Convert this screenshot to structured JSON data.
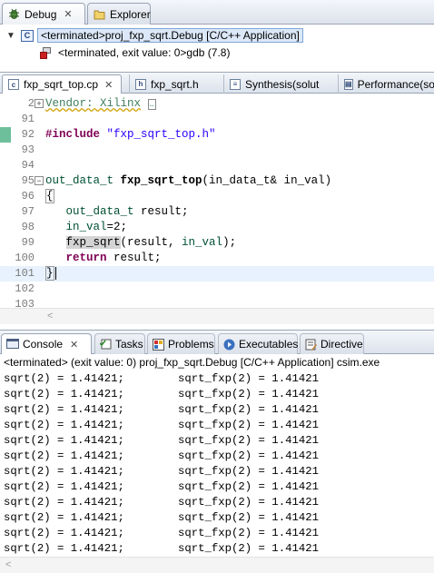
{
  "debug_view": {
    "tabs": [
      {
        "label": "Debug",
        "icon": "debug-bug-icon"
      },
      {
        "label": "Explorer",
        "icon": "folder-icon"
      }
    ],
    "tree": [
      {
        "label": "<terminated>proj_fxp_sqrt.Debug [C/C++ Application]",
        "icon": "c-application-icon"
      },
      {
        "label": "<terminated, exit value: 0>gdb (7.8)",
        "icon": "gdb-process-icon"
      }
    ]
  },
  "editor": {
    "tabs": [
      {
        "label": "fxp_sqrt_top.cp",
        "icon": "c-source-file-icon"
      },
      {
        "label": "fxp_sqrt.h",
        "icon": "header-file-icon"
      },
      {
        "label": "Synthesis(solut",
        "icon": "synthesis-report-icon"
      },
      {
        "label": "Performance(so",
        "icon": "performance-icon"
      }
    ],
    "lines": [
      {
        "num": "2",
        "text": "Vendor: Xilinx "
      },
      {
        "num": "91",
        "text": ""
      },
      {
        "num": "92",
        "text": "#include \"fxp_sqrt_top.h\""
      },
      {
        "num": "93",
        "text": ""
      },
      {
        "num": "94",
        "text": ""
      },
      {
        "num": "95",
        "text": "out_data_t fxp_sqrt_top(in_data_t& in_val)"
      },
      {
        "num": "96",
        "text": "{"
      },
      {
        "num": "97",
        "text": "   out_data_t result;"
      },
      {
        "num": "98",
        "text": "   in_val=2;"
      },
      {
        "num": "99",
        "text": "   fxp_sqrt(result, in_val);"
      },
      {
        "num": "100",
        "text": "   return result;"
      },
      {
        "num": "101",
        "text": "}"
      },
      {
        "num": "102",
        "text": ""
      },
      {
        "num": "103",
        "text": ""
      }
    ],
    "tokens": {
      "l2": "Vendor: Xilinx",
      "l92_kw": "#include",
      "l92_str": "\"fxp_sqrt_top.h\"",
      "l95_type": "out_data_t",
      "l95_fn": "fxp_sqrt_top",
      "l95_rest": "(in_data_t& in_val)",
      "l96": "{",
      "l97_type": "out_data_t",
      "l97_rest": " result;",
      "l98_var": "in_val",
      "l98_rest": "=2;",
      "l99_fn": "fxp_sqrt",
      "l99_rest": "(result, ",
      "l99_var": "in_val",
      "l99_end": ");",
      "l100_kw": "return",
      "l100_rest": " result;",
      "l101": "}"
    }
  },
  "console": {
    "tabs": [
      {
        "label": "Console",
        "icon": "console-icon"
      },
      {
        "label": "Tasks",
        "icon": "tasks-icon"
      },
      {
        "label": "Problems",
        "icon": "problems-icon"
      },
      {
        "label": "Executables",
        "icon": "executables-icon"
      },
      {
        "label": "Directive",
        "icon": "directive-icon"
      }
    ],
    "status": "<terminated> (exit value: 0) proj_fxp_sqrt.Debug [C/C++ Application] csim.exe",
    "rows": [
      {
        "a": "sqrt(2) = 1.41421;",
        "b": "sqrt_fxp(2) = 1.41421"
      },
      {
        "a": "sqrt(2) = 1.41421;",
        "b": "sqrt_fxp(2) = 1.41421"
      },
      {
        "a": "sqrt(2) = 1.41421;",
        "b": "sqrt_fxp(2) = 1.41421"
      },
      {
        "a": "sqrt(2) = 1.41421;",
        "b": "sqrt_fxp(2) = 1.41421"
      },
      {
        "a": "sqrt(2) = 1.41421;",
        "b": "sqrt_fxp(2) = 1.41421"
      },
      {
        "a": "sqrt(2) = 1.41421;",
        "b": "sqrt_fxp(2) = 1.41421"
      },
      {
        "a": "sqrt(2) = 1.41421;",
        "b": "sqrt_fxp(2) = 1.41421"
      },
      {
        "a": "sqrt(2) = 1.41421;",
        "b": "sqrt_fxp(2) = 1.41421"
      },
      {
        "a": "sqrt(2) = 1.41421;",
        "b": "sqrt_fxp(2) = 1.41421"
      },
      {
        "a": "sqrt(2) = 1.41421;",
        "b": "sqrt_fxp(2) = 1.41421"
      },
      {
        "a": "sqrt(2) = 1.41421;",
        "b": "sqrt_fxp(2) = 1.41421"
      },
      {
        "a": "sqrt(2) = 1.41421;",
        "b": "sqrt_fxp(2) = 1.41421"
      }
    ]
  },
  "colors": {
    "keyword": "#7f0055",
    "string": "#2a00ff",
    "type": "#005032",
    "comment": "#3f7f5f",
    "selection": "#dce8f8",
    "current_line": "#e8f2fe"
  }
}
